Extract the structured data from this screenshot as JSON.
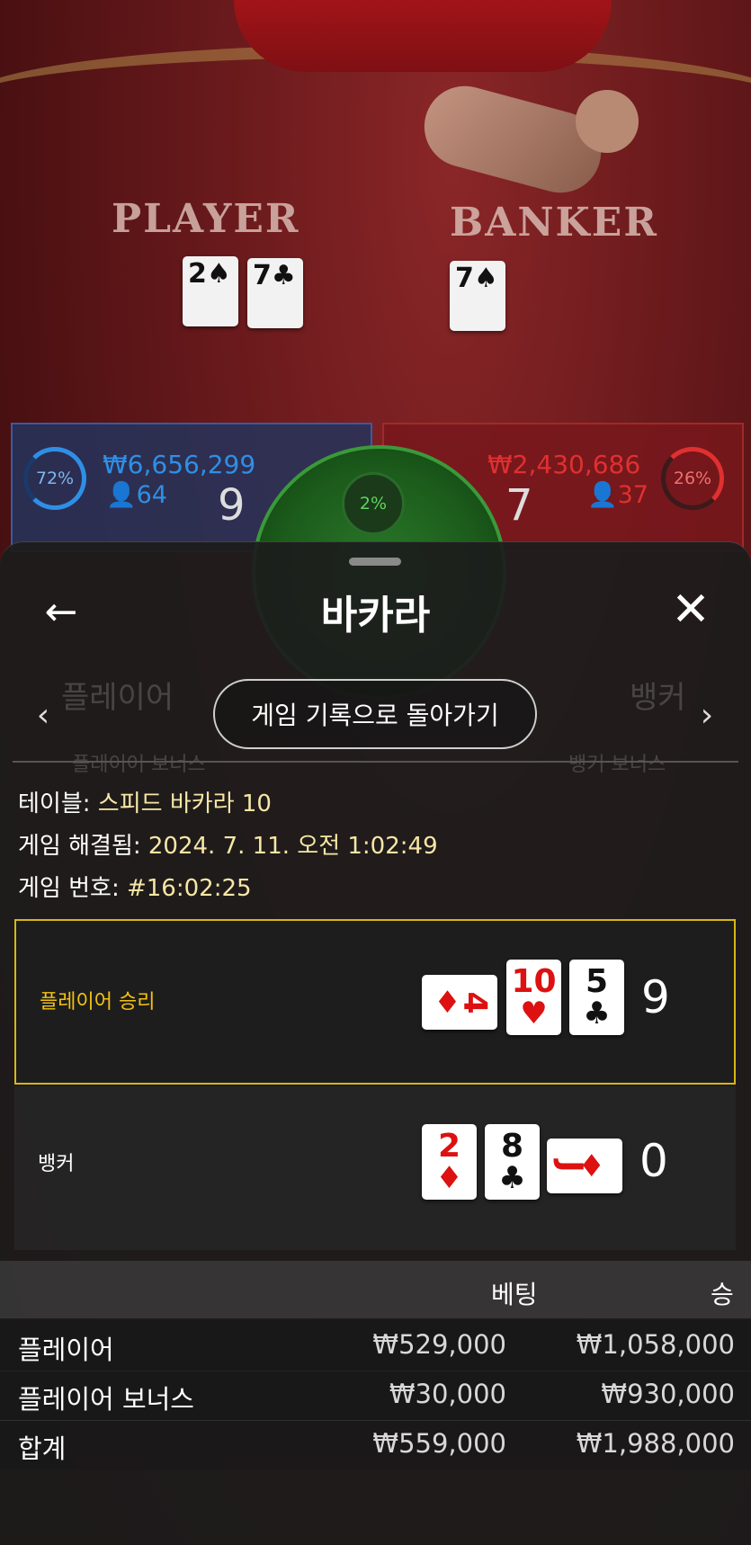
{
  "game": {
    "player_label": "PLAYER",
    "banker_label": "BANKER",
    "player_pct": "72%",
    "banker_pct": "26%",
    "tie_pct": "2%",
    "player_total_bets": "₩6,656,299",
    "banker_total_bets": "₩2,430,686",
    "player_bettors": "64",
    "banker_bettors": "37",
    "player_score": "9",
    "banker_score": "7",
    "felt_player_cards": [
      "2",
      "7"
    ],
    "felt_banker_cards": [
      "7"
    ]
  },
  "sheet": {
    "title": "바카라",
    "history_button": "게임 기록으로 돌아가기",
    "table_label": "테이블:",
    "table_value": "스피드 바카라 10",
    "resolved_label": "게임 해결됨:",
    "resolved_value": "2024. 7. 11. 오전 1:02:49",
    "round_label": "게임 번호:",
    "round_value": "#16:02:25"
  },
  "results": {
    "player": {
      "label": "플레이어 승리",
      "total": "9",
      "cards": [
        {
          "rank": "4",
          "suit": "♦",
          "color": "red",
          "orientation": "horizontal"
        },
        {
          "rank": "10",
          "suit": "♥",
          "color": "red",
          "orientation": "vertical"
        },
        {
          "rank": "5",
          "suit": "♣",
          "color": "black",
          "orientation": "vertical"
        }
      ]
    },
    "banker": {
      "label": "뱅커",
      "total": "0",
      "cards": [
        {
          "rank": "2",
          "suit": "♦",
          "color": "red",
          "orientation": "vertical"
        },
        {
          "rank": "8",
          "suit": "♣",
          "color": "black",
          "orientation": "vertical"
        },
        {
          "rank": "J",
          "suit": "♦",
          "color": "red",
          "orientation": "horizontal"
        }
      ]
    }
  },
  "bets": {
    "header_bet": "베팅",
    "header_win": "승",
    "rows": [
      {
        "name": "플레이어",
        "bet": "₩529,000",
        "win": "₩1,058,000"
      },
      {
        "name": "플레이어 보너스",
        "bet": "₩30,000",
        "win": "₩930,000"
      },
      {
        "name": "합계",
        "bet": "₩559,000",
        "win": "₩1,988,000"
      }
    ]
  },
  "ghost": {
    "player_tab": "플레이어",
    "banker_tab": "뱅커",
    "player_bonus": "플레이어 보너스",
    "banker_bonus": "뱅커 보너스"
  },
  "colors": {
    "player_blue": "#2f8fe6",
    "banker_red": "#e03030",
    "win_highlight": "#d6b815",
    "info_value": "#f6e7a6"
  }
}
